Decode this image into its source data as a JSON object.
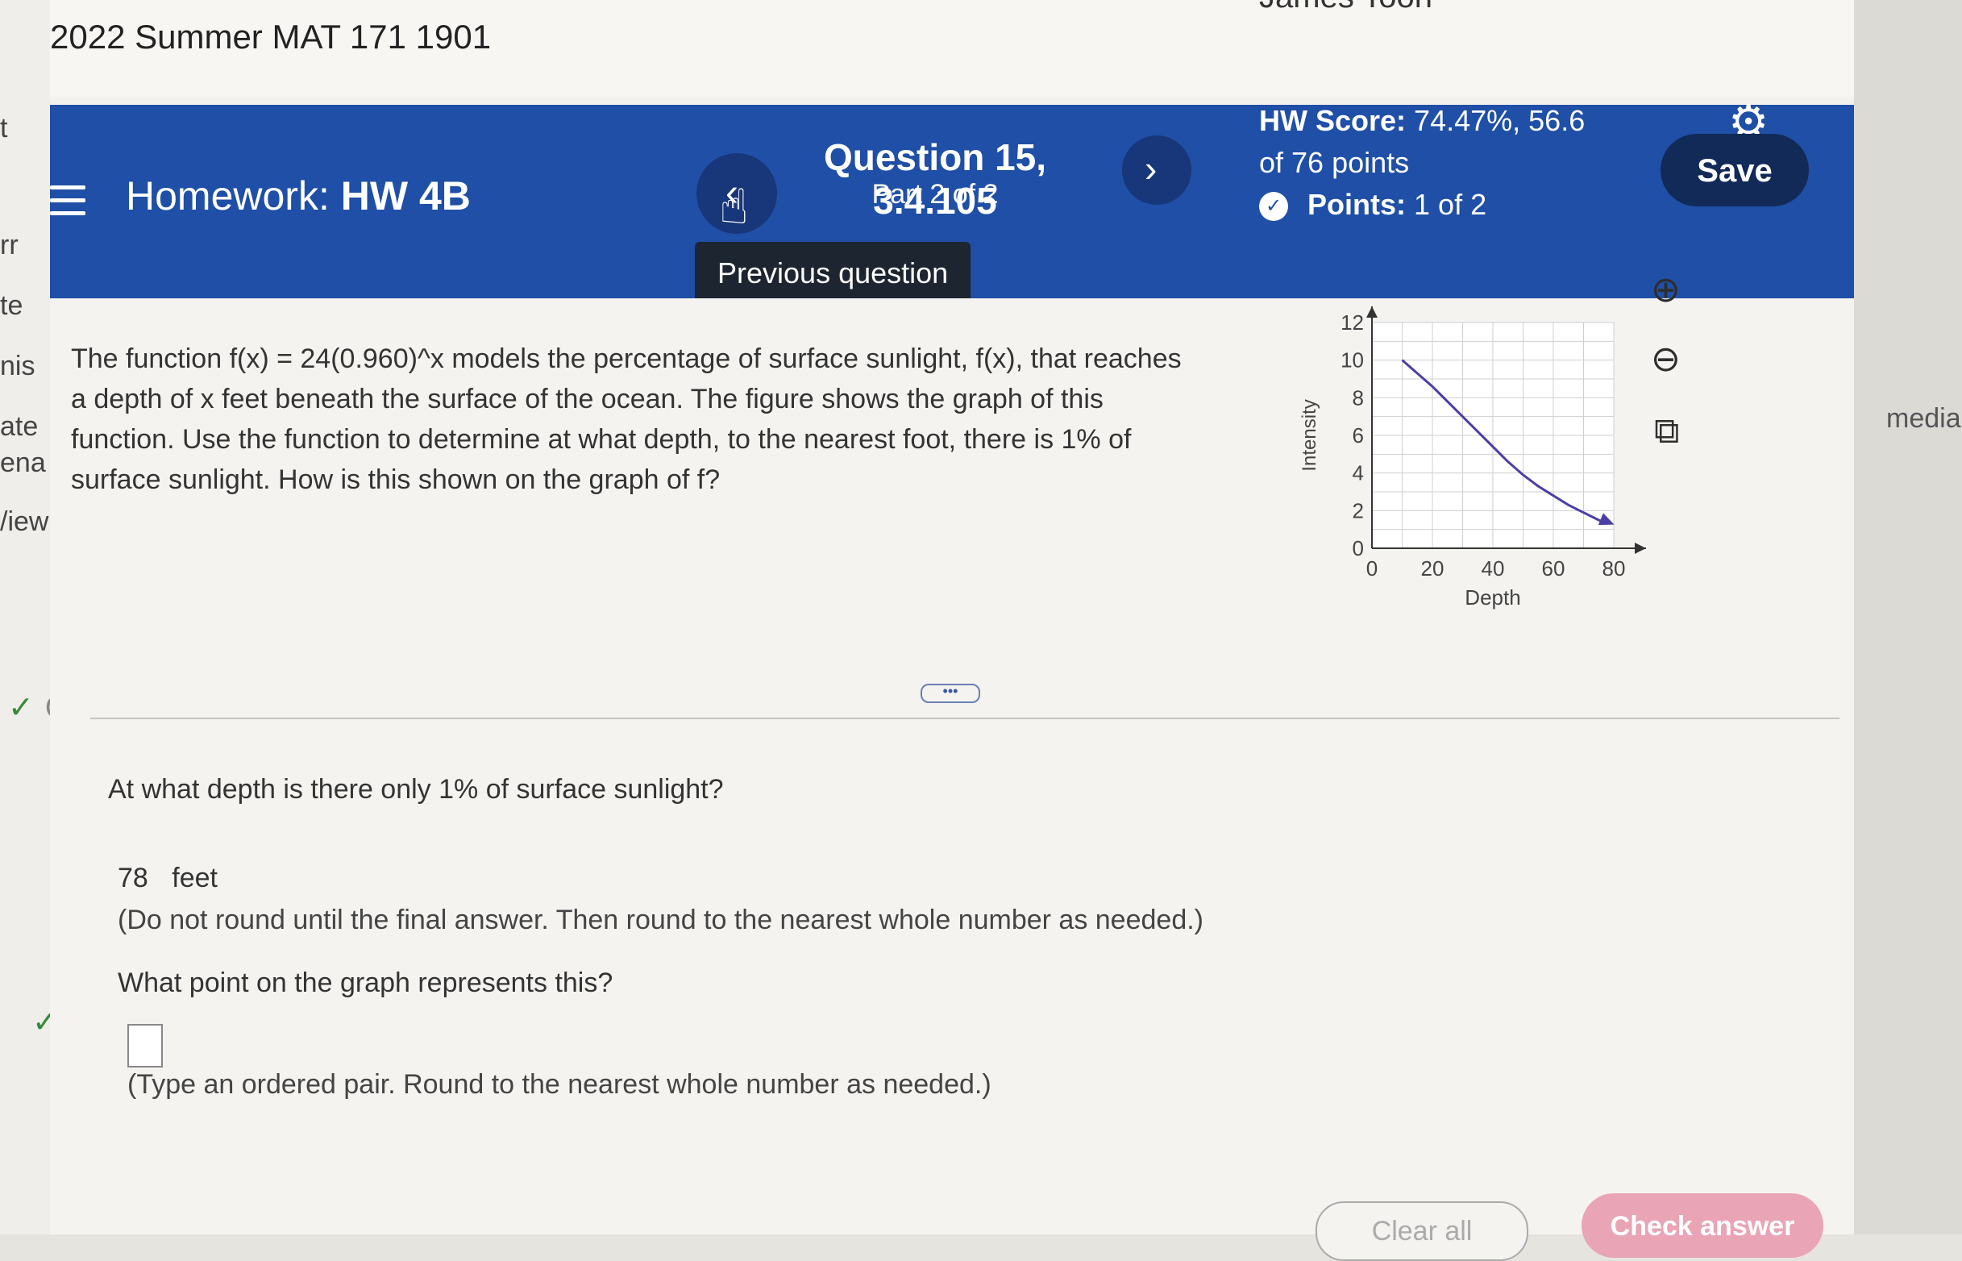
{
  "course": {
    "title": "2022 Summer MAT 171 1901",
    "user": "James Toon"
  },
  "header": {
    "homework_prefix": "Homework:",
    "homework_name": "HW 4B",
    "question_title": "Question 15, 3.4.105",
    "question_part": "Part 2 of 2",
    "hw_score_label": "HW Score:",
    "hw_score_value": "74.47%, 56.6",
    "hw_score_total": "of 76 points",
    "points_label": "Points:",
    "points_value": "1 of 2",
    "save_label": "Save",
    "prev_tooltip": "Previous question",
    "icons": {
      "menu": "menu-icon",
      "prev": "chevron-left-icon",
      "next": "chevron-right-icon",
      "settings": "gear-icon",
      "points": "partial-credit-icon"
    }
  },
  "problem": {
    "text": "The function f(x) = 24(0.960)^x models the percentage of surface sunlight, f(x), that reaches a depth of x feet beneath the surface of the ocean. The figure shows the graph of this function. Use the function to determine at what depth, to the nearest foot, there is 1% of surface sunlight. How is this shown on the graph of f?"
  },
  "graph_tools": {
    "zoom_in": "zoom-in-icon",
    "zoom_out": "zoom-out-icon",
    "popout": "external-link-icon"
  },
  "chart_data": {
    "type": "line",
    "title": "",
    "xlabel": "Depth",
    "ylabel": "Intensity",
    "xlim": [
      0,
      80
    ],
    "ylim": [
      0,
      12
    ],
    "x_ticks": [
      0,
      20,
      40,
      60,
      80
    ],
    "y_ticks": [
      0,
      2,
      4,
      6,
      8,
      10,
      12
    ],
    "grid": true,
    "series": [
      {
        "x": [
          10,
          15,
          20,
          25,
          30,
          35,
          40,
          45,
          50,
          55,
          60,
          65,
          70,
          75,
          78
        ],
        "y": [
          10.0,
          9.3,
          8.6,
          7.8,
          7.0,
          6.2,
          5.4,
          4.6,
          3.9,
          3.3,
          2.8,
          2.3,
          1.9,
          1.5,
          1.3
        ],
        "color": "#4b3fa3"
      }
    ]
  },
  "answers": {
    "q1_text": "At what depth is there only 1% of surface sunlight?",
    "q1_value": "78",
    "q1_unit": "feet",
    "q1_note": "(Do not round until the final answer. Then round to the nearest whole number as needed.)",
    "q2_text": "What point on the graph represents this?",
    "q2_value": "",
    "q2_note": "(Type an ordered pair. Round to the nearest whole number as needed.)"
  },
  "buttons": {
    "clear_all": "Clear all",
    "check_answer": "Check answer"
  },
  "left_fragments": [
    "t",
    "rr",
    "te",
    "nis",
    "ate",
    "ena",
    "/iew"
  ],
  "right_fragment": "media."
}
